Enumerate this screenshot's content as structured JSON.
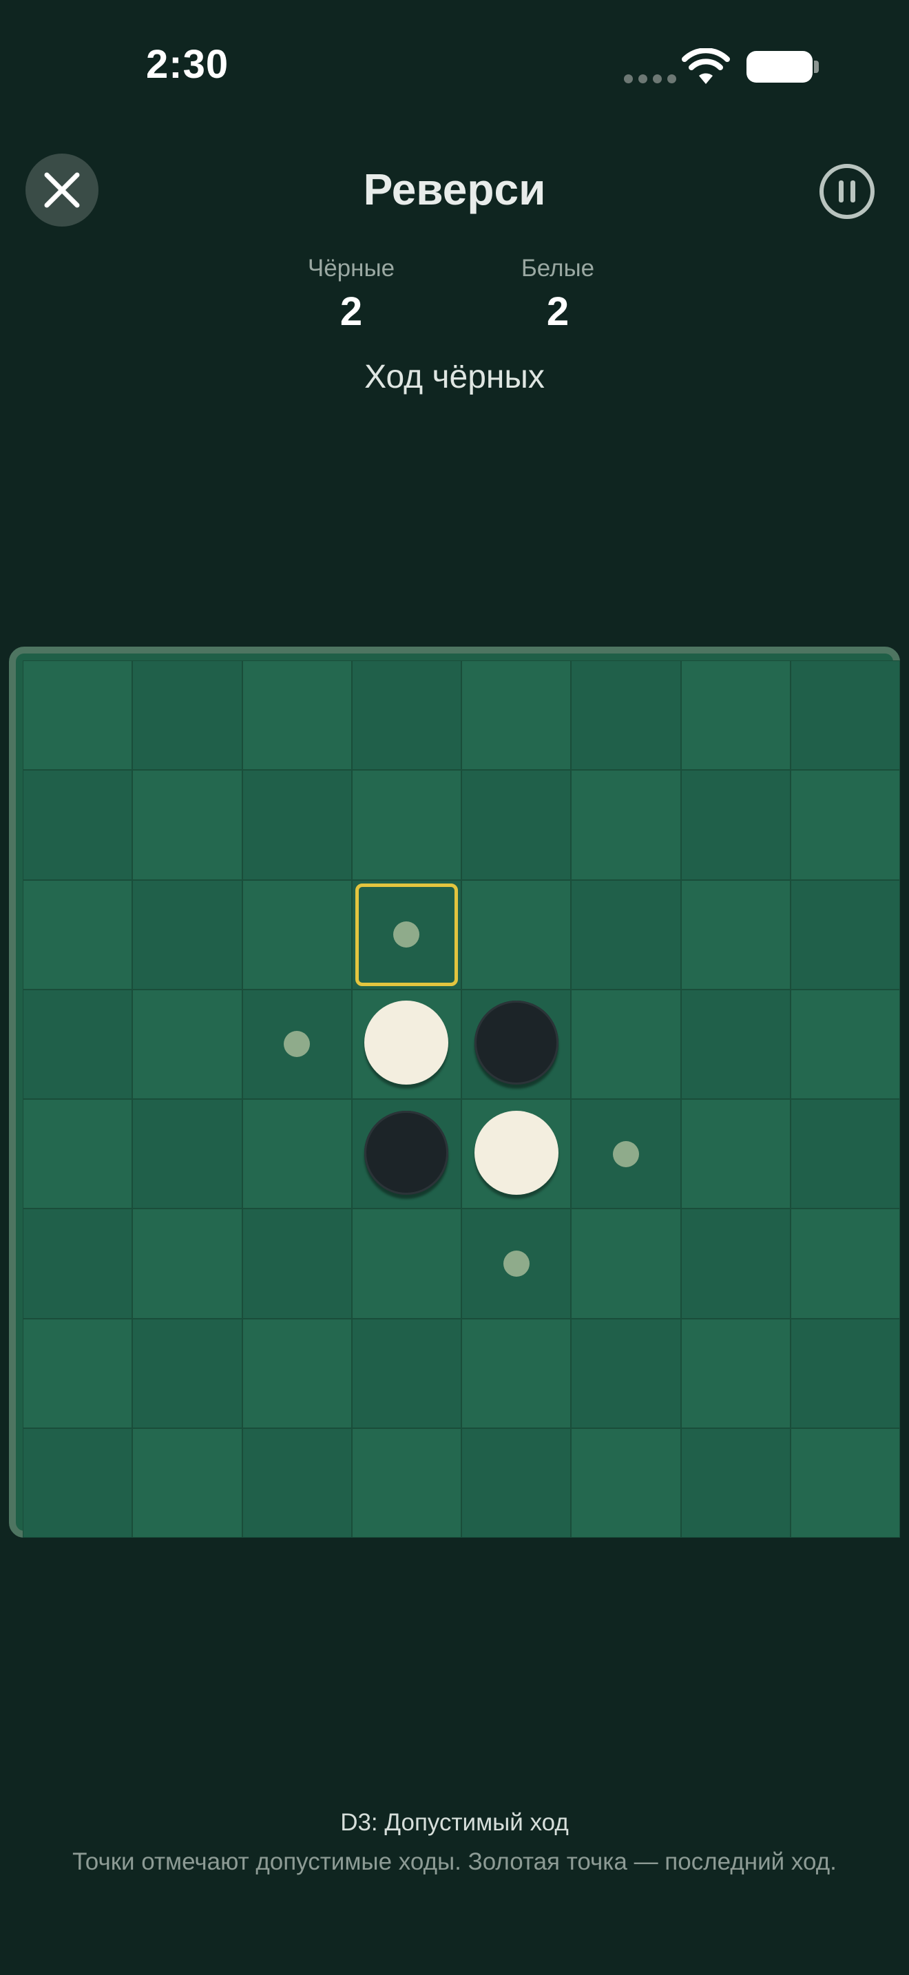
{
  "status_bar": {
    "time": "2:30"
  },
  "header": {
    "title": "Реверси",
    "close_icon": "close-icon",
    "pause_icon": "pause-icon"
  },
  "score": {
    "black_label": "Чёрные",
    "black_value": "2",
    "white_label": "Белые",
    "white_value": "2"
  },
  "turn_text": "Ход чёрных",
  "board": {
    "size": 8,
    "colors": {
      "light": "#24684f",
      "dark": "#20604a",
      "frame": "#4e7561",
      "hint_dot": "#8fab8b",
      "last_move_highlight": "#e3c53f",
      "white_disc": "#f3eedf",
      "black_disc": "#1c2428"
    },
    "discs": [
      {
        "row": 3,
        "col": 3,
        "color": "white"
      },
      {
        "row": 3,
        "col": 4,
        "color": "black"
      },
      {
        "row": 4,
        "col": 3,
        "color": "black"
      },
      {
        "row": 4,
        "col": 4,
        "color": "white"
      }
    ],
    "valid_moves": [
      {
        "row": 2,
        "col": 3
      },
      {
        "row": 3,
        "col": 2
      },
      {
        "row": 4,
        "col": 5
      },
      {
        "row": 5,
        "col": 4
      }
    ],
    "highlighted_cell": {
      "row": 2,
      "col": 3
    }
  },
  "footer": {
    "status": "D3: Допустимый ход",
    "hint": "Точки отмечают допустимые ходы. Золотая точка — последний ход."
  }
}
